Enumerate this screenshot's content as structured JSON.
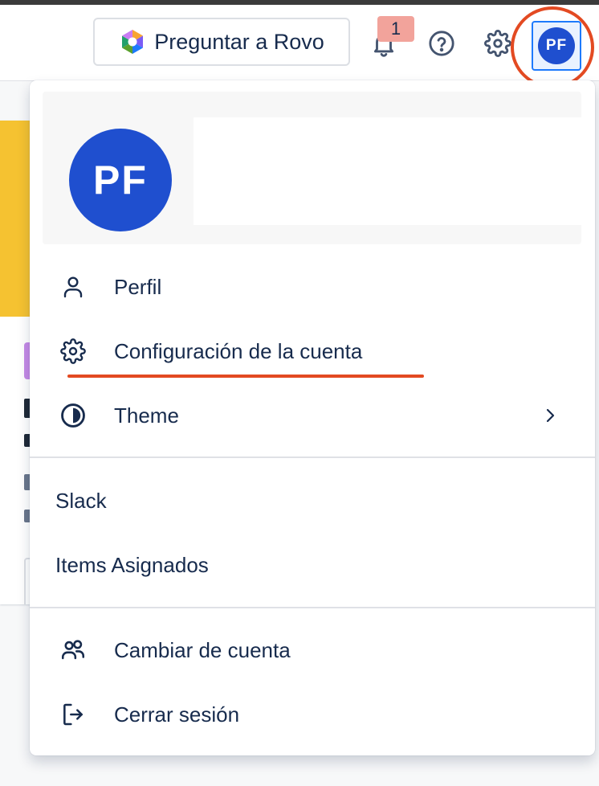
{
  "topbar": {
    "rovo_button_label": "Preguntar a Rovo",
    "notifications_count": "1",
    "avatar_initials": "PF"
  },
  "dropdown": {
    "avatar_initials": "PF",
    "items": [
      {
        "label": "Perfil",
        "icon": "person-icon"
      },
      {
        "label": "Configuración de la cuenta",
        "icon": "gear-icon"
      },
      {
        "label": "Theme",
        "icon": "theme-icon"
      },
      {
        "label": "Slack"
      },
      {
        "label": "Items Asignados"
      },
      {
        "label": "Cambiar de cuenta",
        "icon": "people-icon"
      },
      {
        "label": "Cerrar sesión",
        "icon": "logout-icon"
      }
    ]
  },
  "colors": {
    "avatar": "#1f4fcf",
    "annotation": "#e34a22",
    "badge": "#f2a39b",
    "accent_yellow": "#f5c231"
  }
}
